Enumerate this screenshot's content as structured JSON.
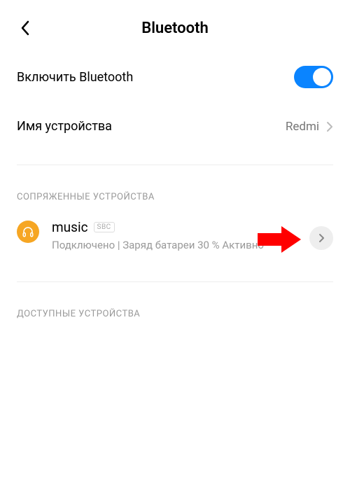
{
  "header": {
    "title": "Bluetooth"
  },
  "settings": {
    "enableBluetooth": {
      "label": "Включить Bluetooth",
      "enabled": true
    },
    "deviceName": {
      "label": "Имя устройства",
      "value": "Redmi"
    }
  },
  "sections": {
    "paired": {
      "title": "СОПРЯЖЕННЫЕ УСТРОЙСТВА",
      "devices": [
        {
          "name": "music",
          "codec": "SBC",
          "status": "Подключено | Заряд батареи 30 % Активно",
          "iconType": "headphones"
        }
      ]
    },
    "available": {
      "title": "ДОСТУПНЫЕ УСТРОЙСТВА"
    }
  },
  "colors": {
    "accent": "#0a84ff",
    "deviceIconBg": "#f6a623",
    "annotationArrow": "#ff0000"
  }
}
